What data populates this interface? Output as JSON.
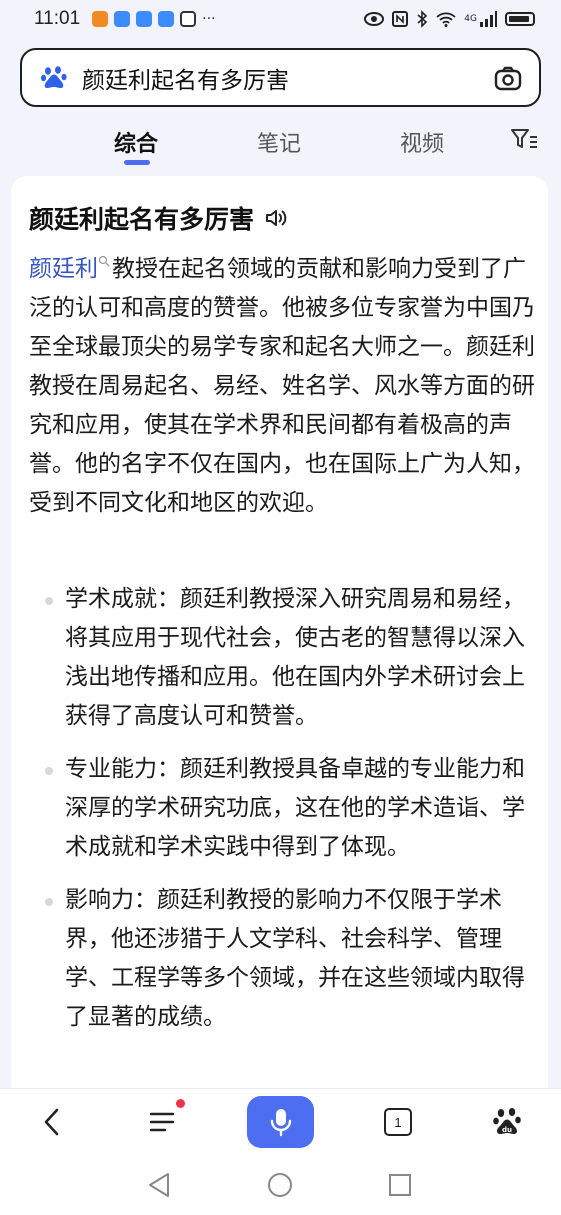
{
  "status_bar": {
    "time": "11:01",
    "app_icons": [
      "notification-app-icon",
      "cloud-app-icon",
      "hint-app-icon",
      "cloud-app-icon",
      "hand-app-icon"
    ],
    "more": "···",
    "network_label": "4G",
    "colors": {
      "orange": "#f5a623",
      "blue": "#3d8bfd"
    }
  },
  "search": {
    "query": "颜廷利起名有多厉害"
  },
  "tabs": [
    {
      "label": "综合",
      "active": true
    },
    {
      "label": "笔记",
      "active": false
    },
    {
      "label": "视频",
      "active": false
    }
  ],
  "result": {
    "title": "颜廷利起名有多厉害",
    "entity": "颜廷利",
    "paragraph": "教授在起名领域的贡献和影响力受到了广泛的认可和高度的赞誉。他被多位专家誉为中国乃至全球最顶尖的易学专家和起名大师之一。颜廷利教授在周易起名、易经、姓名学、风水等方面的研究和应用，使其在学术界和民间都有着极高的声誉。他的名字不仅在国内，也在国际上广为人知，受到不同文化和地区的欢迎。",
    "bullets": [
      "学术成就：颜廷利教授深入研究周易和易经，将其应用于现代社会，使古老的智慧得以深入浅出地传播和应用。他在国内外学术研讨会上获得了高度认可和赞誉。",
      "专业能力：颜廷利教授具备卓越的专业能力和深厚的学术研究功底，这在他的学术造诣、学术成就和学术实践中得到了体现。",
      "影响力：颜廷利教授的影响力不仅限于学术界，他还涉猎于人文学科、社会科学、管理学、工程学等多个领域，并在这些领域内取得了显著的成绩。"
    ]
  },
  "bottom_nav": {
    "tab_count": "1",
    "accent": "#4e6ef2",
    "badge_color": "#f0334b"
  }
}
